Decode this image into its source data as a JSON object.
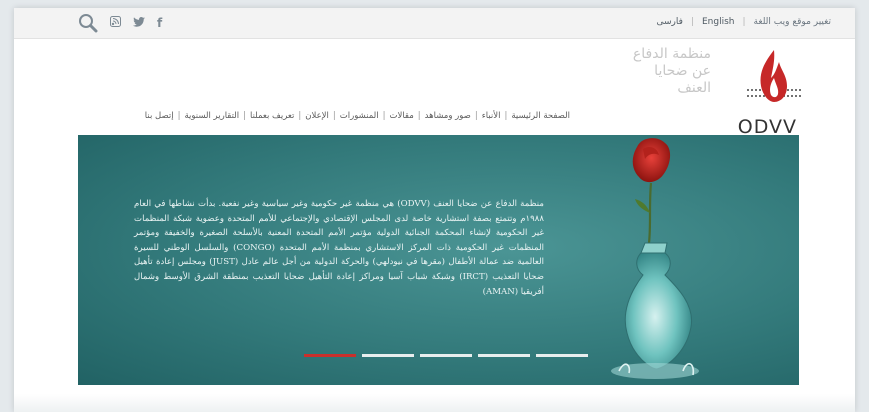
{
  "topbar": {
    "social": [
      {
        "icon": "search-icon"
      },
      {
        "icon": "rss-icon",
        "glyph": "⊞"
      },
      {
        "icon": "twitter-icon",
        "glyph": "🐦"
      },
      {
        "icon": "facebook-icon",
        "glyph": "f"
      }
    ],
    "languages": {
      "arabic": "تغيير موقع ويب اللغة",
      "english": "English",
      "persian": "فارسی"
    }
  },
  "logo": {
    "tagline": "منظمة الدفاع عن ضحايا العنف",
    "word": "ODVV",
    "colors": {
      "flame": "#c62828",
      "text": "#333333"
    }
  },
  "nav": {
    "items": [
      "الصفحة الرئيسية",
      "الأنباء",
      "صور ومشاهد",
      "مقالات",
      "المنشورات",
      "الإعلان",
      "تعريف بعملنا",
      "التقارير السنوية",
      "إتصل بنا"
    ]
  },
  "slider": {
    "text": "منظمة الدفاع عن ضحايا العنف (ODVV) هي منظمة غير حكومية وغير سياسية وغير نفعية. بدأت نشاطها في العام ١٩٨٨م وتتمتع بصفة استشارية خاصة لدى المجلس الإقتصادي والإجتماعي للأمم المتحدة وعضوية شبكة المنظمات غير الحكومية لإنشاء المحكمة الجنائية الدولية مؤتمر الأمم المتحدة المعنية بالأسلحة الصغيرة والخفيفة ومؤتمر المنظمات غير الحكومية ذات المركز الاستشاري بمنظمة الأمم المتحدة (CONGO) والسلسل الوطني للسيرة العالمية ضد عمالة الأطفال (مقرها في نيودلهي) والحركة الدولية من أجل عالم عادل (JUST) ومجلس إعادة تأهيل ضحايا التعذيب (IRCT) وشبكة شباب آسيا ومراكز إعادة التأهيل ضحايا التعذيب بمنطقة الشرق الأوسط وشمال أفريقيا (AMAN)",
    "active_index": 0,
    "slide_count": 5,
    "accent": "#c9302c",
    "background": "#337a7b"
  }
}
